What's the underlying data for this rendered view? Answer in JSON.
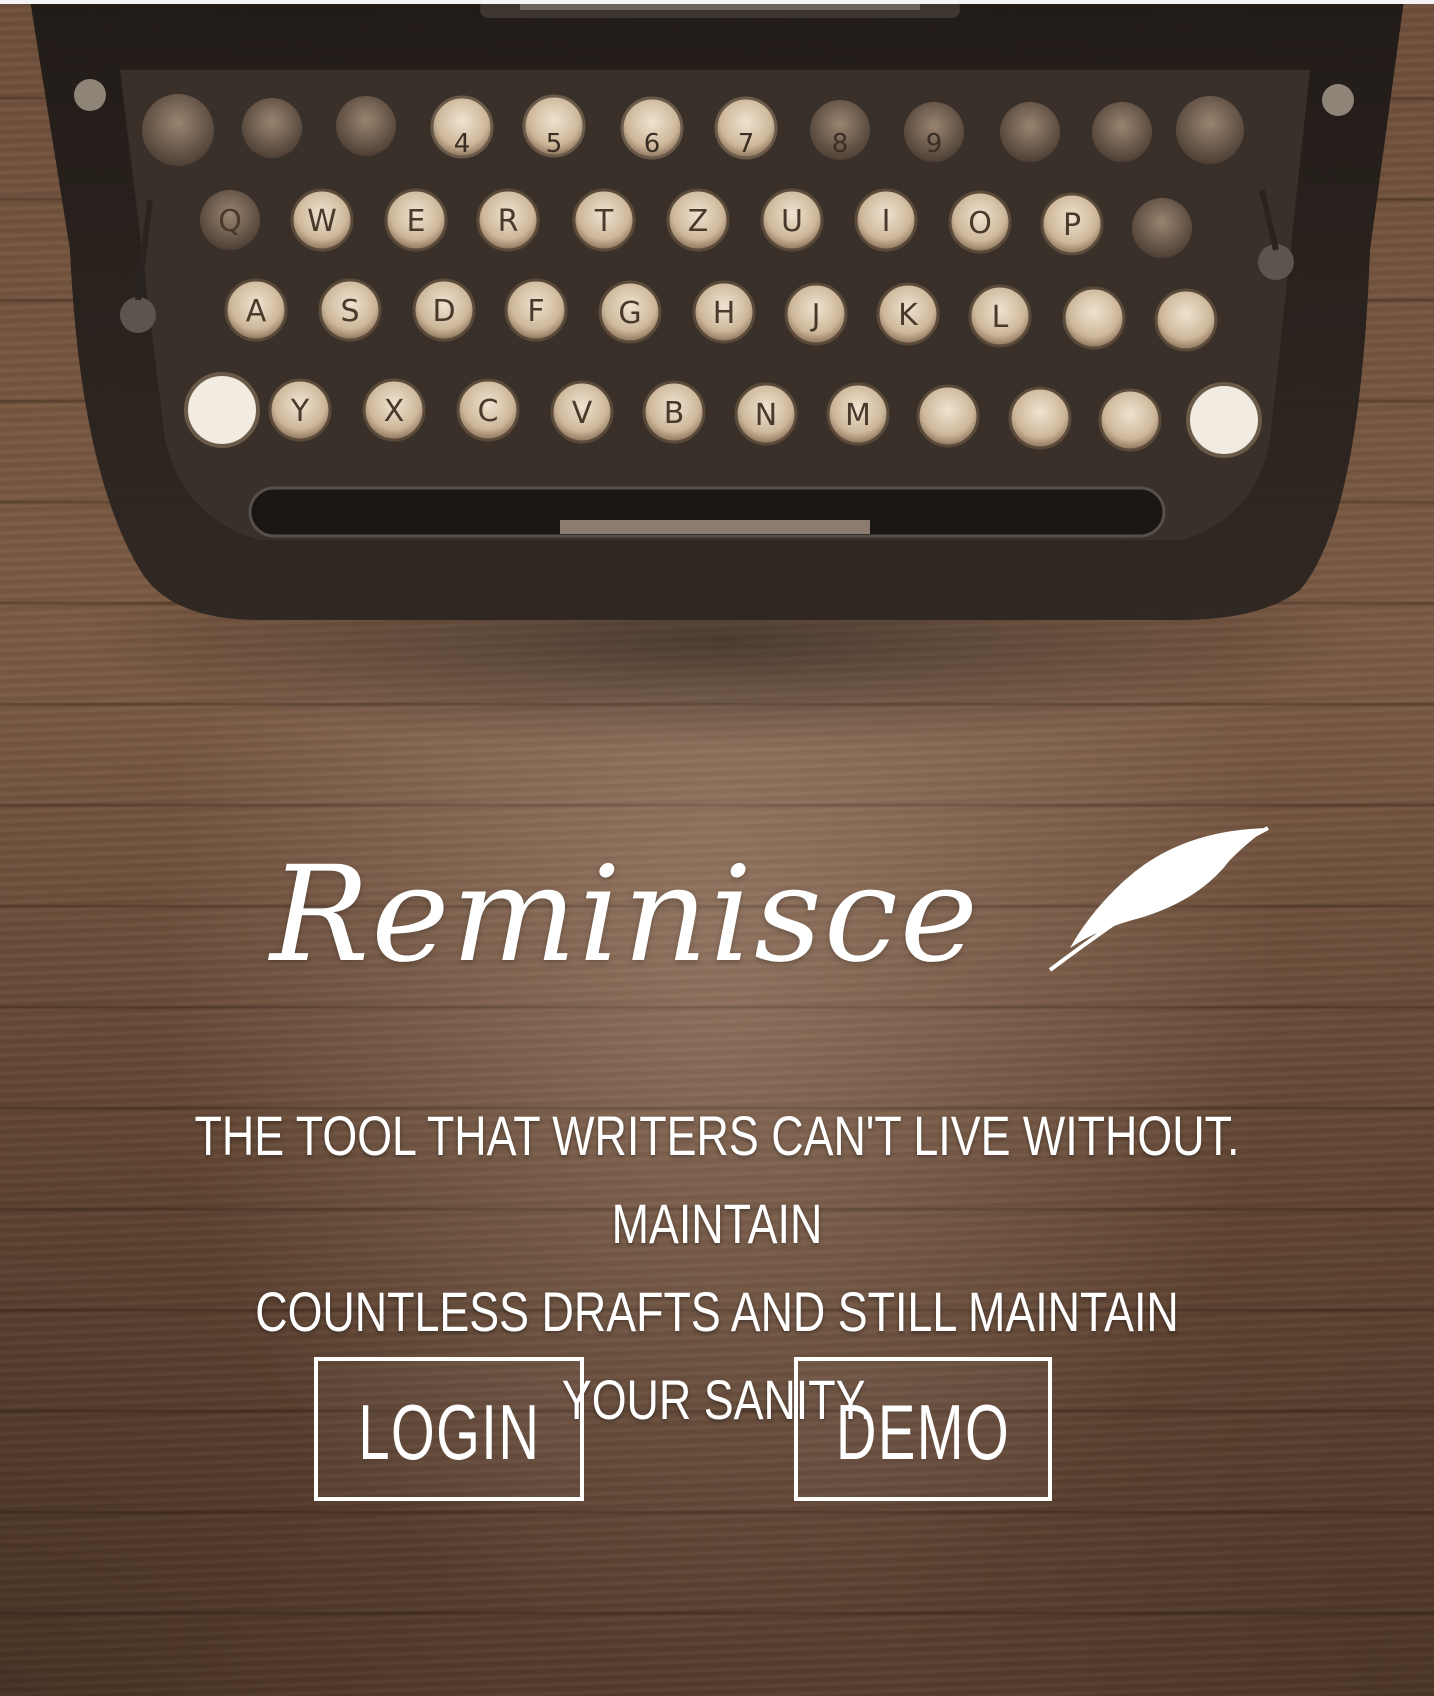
{
  "app": {
    "name": "Reminisce",
    "logo_icon": "quill-icon"
  },
  "hero": {
    "tagline_line1": "THE TOOL THAT WRITERS CAN'T LIVE WITHOUT. MAINTAIN",
    "tagline_line2": "COUNTLESS DRAFTS AND STILL MAINTAIN YOUR SANITY."
  },
  "actions": {
    "login_label": "LOGIN",
    "demo_label": "DEMO"
  },
  "colors": {
    "text": "#ffffff",
    "wood": "#6d4e3a",
    "typewriter_body": "#2a2420"
  }
}
